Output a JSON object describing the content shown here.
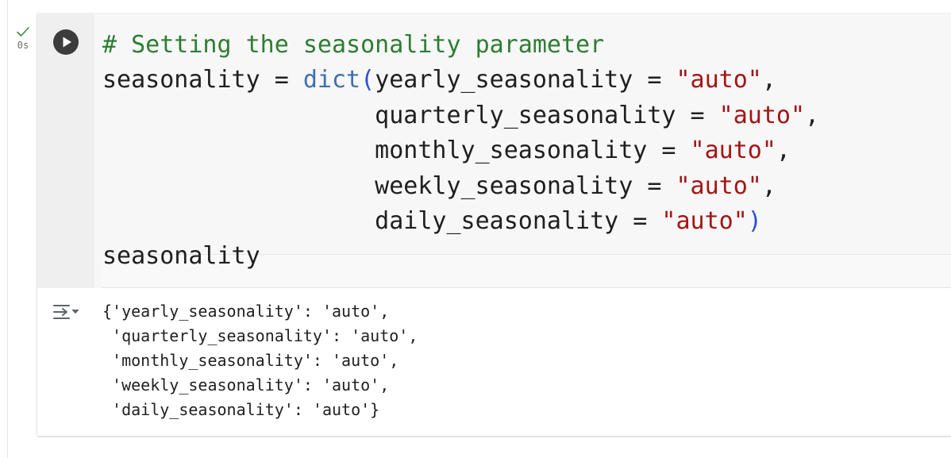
{
  "execution": {
    "check_icon": "check-icon",
    "time": "0s"
  },
  "cell": {
    "run_icon": "play-icon",
    "code": {
      "comment": "# Setting the seasonality parameter",
      "l2_var": "seasonality",
      "l2_op": " = ",
      "l2_func": "dict",
      "l2_paren": "(",
      "l2_arg": "yearly_seasonality = ",
      "l2_val": "\"auto\"",
      "l2_comma": ",",
      "indent": "                   ",
      "l3_arg": "quarterly_seasonality = ",
      "l3_val": "\"auto\"",
      "l3_comma": ",",
      "l4_arg": "monthly_seasonality = ",
      "l4_val": "\"auto\"",
      "l4_comma": ",",
      "l5_arg": "weekly_seasonality = ",
      "l5_val": "\"auto\"",
      "l5_comma": ",",
      "l6_arg": "daily_seasonality = ",
      "l6_val": "\"auto\"",
      "l6_paren": ")",
      "l7": "seasonality"
    },
    "output": {
      "toggle_icon": "output-toggle-icon",
      "lines": [
        "{'yearly_seasonality': 'auto',",
        " 'quarterly_seasonality': 'auto',",
        " 'monthly_seasonality': 'auto',",
        " 'weekly_seasonality': 'auto',",
        " 'daily_seasonality': 'auto'}"
      ]
    }
  },
  "colors": {
    "comment": "#2e7d32",
    "builtin": "#3f6fb0",
    "string": "#a31515",
    "paren_highlight": "#2b4fd6",
    "run_button": "#3c3c3c",
    "check": "#3a8c3a"
  }
}
